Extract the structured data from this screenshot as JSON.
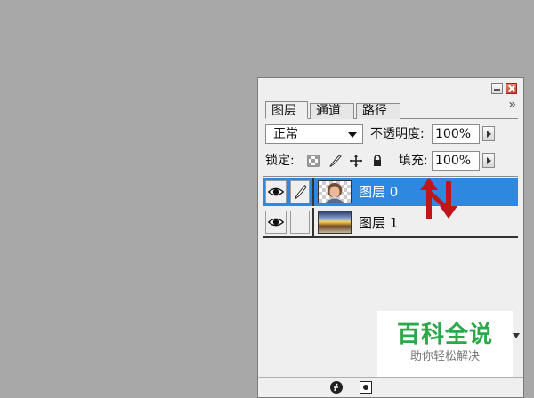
{
  "panel": {
    "tabs": [
      {
        "label": "图层",
        "active": true
      },
      {
        "label": "通道",
        "active": false
      },
      {
        "label": "路径",
        "active": false
      }
    ],
    "menu_glyph": "»"
  },
  "options": {
    "blend_mode": "正常",
    "opacity_label": "不透明度:",
    "opacity_value": "100%",
    "lock_label": "锁定:",
    "fill_label": "填充:",
    "fill_value": "100%"
  },
  "layers": [
    {
      "name": "图层 0",
      "selected": true
    },
    {
      "name": "图层 1",
      "selected": false
    }
  ],
  "watermark": {
    "title": "百科全说",
    "subtitle": "助你轻松解决"
  },
  "colors": {
    "selection": "#2e88e0",
    "annotation_arrows": "#c0151b",
    "watermark_green": "#2ba84a"
  }
}
